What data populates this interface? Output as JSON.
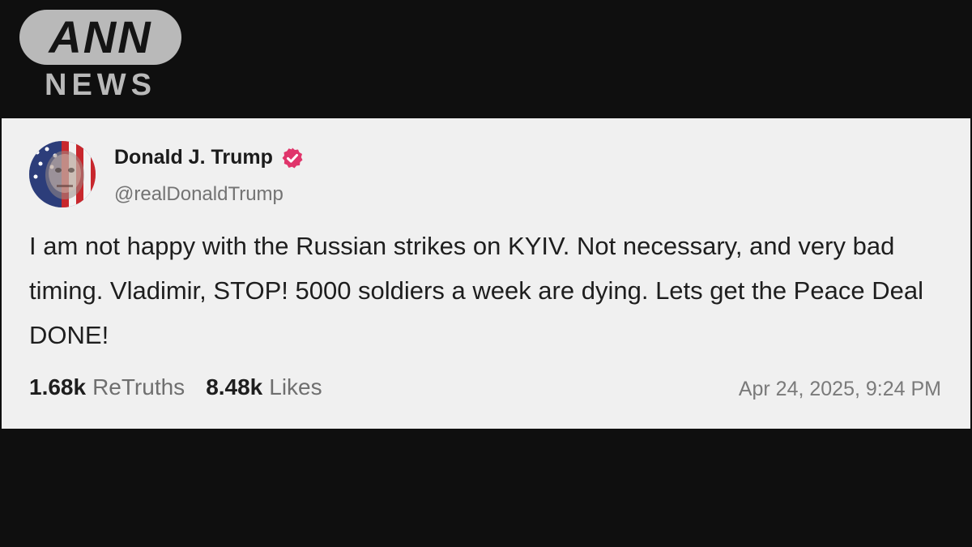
{
  "logo": {
    "line1": "ANN",
    "line2": "NEWS"
  },
  "post": {
    "author": {
      "display_name": "Donald J. Trump",
      "handle": "@realDonaldTrump",
      "verified_icon": "verified-badge-icon"
    },
    "text": "I am not happy with the Russian strikes on KYIV. Not necessary, and very bad timing. Vladimir, STOP! 5000 soldiers a week are dying. Lets get the Peace Deal DONE!",
    "stats": {
      "retruths_count": "1.68k",
      "retruths_label": "ReTruths",
      "likes_count": "8.48k",
      "likes_label": "Likes"
    },
    "timestamp": "Apr 24, 2025, 9:24 PM"
  },
  "colors": {
    "background": "#0f0f0f",
    "card": "#f0f0f0",
    "verified": "#e0356b",
    "logo": "#b9b9b9"
  }
}
